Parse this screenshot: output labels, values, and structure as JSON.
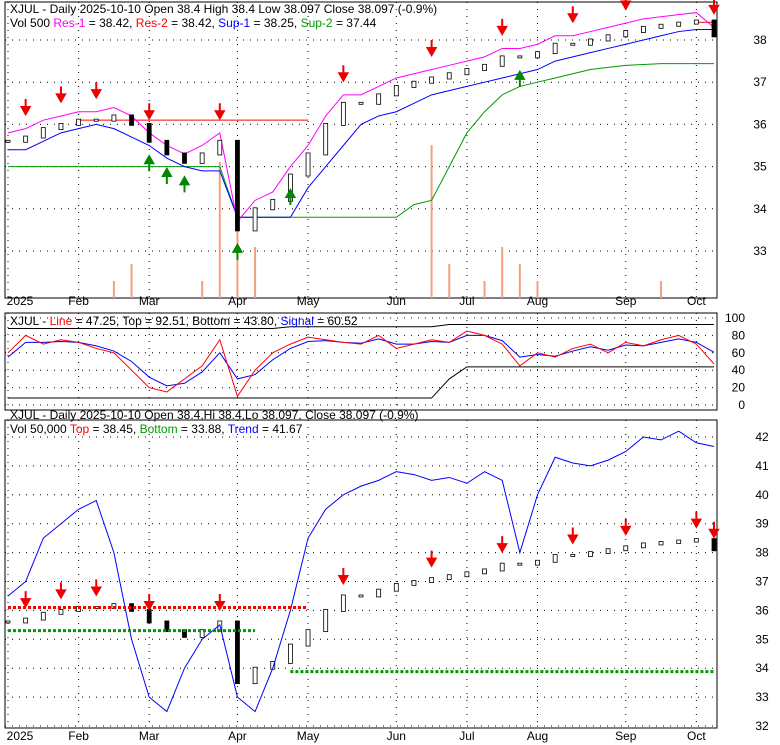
{
  "colors": {
    "res1": "#ff00ff",
    "res2": "#ff0000",
    "sup1": "#0000ff",
    "sup2": "#009900",
    "line": "#ff0000",
    "signal": "#0000ff",
    "top": "#ff0000",
    "bottom": "#009900",
    "trend": "#0000ff",
    "volume": "#f4a080"
  },
  "panel1": {
    "ticker": "XJUL",
    "title": "XJUL - Daily 2025-10-10 Open 38.4  High 38.4  Low 38.097  Close 38.097 (-0.9%)",
    "vol": "Vol 500",
    "res1_label": "Res-1",
    "res1_val": " = 38.42, ",
    "res2_label": "Res-2",
    "res2_val": " = 38.42, ",
    "sup1_label": "Sup-1",
    "sup1_val": " = 38.25, ",
    "sup2_label": "Sup-2",
    "sup2_val": " = 37.44",
    "yticks": [
      33,
      34,
      35,
      36,
      37,
      38
    ]
  },
  "panel2": {
    "title_pre": "XJUL - ",
    "line_label": "Line",
    "line_val": " = 47.25, Top = 92.51, Bottom = 43.80, ",
    "signal_label": "Signal",
    "signal_val": " = 60.52",
    "yticks": [
      0,
      20,
      40,
      60,
      80,
      100
    ]
  },
  "panel3": {
    "title": "XJUL - Daily 2025-10-10 Open 38.4,Hi 38.4,Lo 38.097, Close 38.097 (-0.9%)",
    "vol": "Vol 50,000 ",
    "top_label": "Top",
    "top_val": " = 38.45, ",
    "bottom_label": "Bottom",
    "bottom_val": " = 33.88, ",
    "trend_label": "Trend",
    "trend_val": " = 41.67",
    "yticks": [
      32,
      33,
      34,
      35,
      36,
      37,
      38,
      39,
      40,
      41,
      42
    ]
  },
  "x_labels": [
    "2025",
    "Feb",
    "Mar",
    "Apr",
    "May",
    "Jun",
    "Jul",
    "Aug",
    "Sep",
    "Oct"
  ],
  "chart_data": {
    "type": "line",
    "x_label_index": [
      0,
      4,
      8,
      13,
      17,
      22,
      26,
      30,
      35,
      39
    ],
    "close": [
      35.6,
      35.7,
      35.9,
      36.0,
      36.1,
      36.1,
      36.2,
      36.0,
      35.6,
      35.3,
      35.1,
      35.3,
      35.6,
      33.5,
      34.0,
      34.2,
      34.8,
      35.3,
      36.0,
      36.5,
      36.5,
      36.7,
      36.9,
      37.0,
      37.1,
      37.2,
      37.3,
      37.4,
      37.6,
      37.6,
      37.7,
      37.9,
      37.9,
      38.0,
      38.1,
      38.2,
      38.3,
      38.35,
      38.4,
      38.45,
      38.097
    ],
    "res2": [
      null,
      null,
      null,
      null,
      36.1,
      36.1,
      36.1,
      36.1,
      36.1,
      36.1,
      36.1,
      36.1,
      36.1,
      36.1,
      36.1,
      36.1,
      36.1,
      36.1,
      null,
      null,
      null,
      null,
      null,
      null,
      null,
      null,
      null,
      null,
      null,
      null,
      null,
      null,
      null,
      null,
      null,
      null,
      null,
      null,
      null,
      38.42,
      38.42
    ],
    "sup1": [
      35.4,
      35.4,
      35.6,
      35.8,
      35.9,
      36,
      35.9,
      35.7,
      35.5,
      35.2,
      35,
      34.9,
      34.9,
      33.8,
      33.8,
      33.8,
      33.8,
      34.5,
      35,
      35.5,
      36,
      36.2,
      36.3,
      36.5,
      36.7,
      36.8,
      36.9,
      37,
      37.1,
      37.2,
      37.3,
      37.5,
      37.6,
      37.7,
      37.8,
      37.9,
      38.0,
      38.1,
      38.2,
      38.25,
      38.25
    ],
    "sup2": [
      35,
      35,
      35,
      35,
      35,
      35,
      35,
      35,
      35,
      35,
      35,
      35,
      35,
      33.8,
      33.8,
      33.8,
      33.8,
      33.8,
      33.8,
      33.8,
      33.8,
      33.8,
      33.8,
      34.1,
      34.2,
      35,
      35.8,
      36.3,
      36.7,
      36.9,
      37.0,
      37.1,
      37.2,
      37.3,
      37.35,
      37.4,
      37.42,
      37.44,
      37.44,
      37.44,
      37.44
    ],
    "osc_line": [
      60,
      80,
      70,
      75,
      72,
      65,
      60,
      40,
      20,
      15,
      30,
      45,
      75,
      10,
      40,
      60,
      70,
      78,
      75,
      72,
      70,
      80,
      65,
      70,
      75,
      72,
      85,
      80,
      70,
      45,
      60,
      55,
      65,
      70,
      60,
      72,
      68,
      75,
      80,
      70,
      47.25
    ],
    "osc_signal": [
      55,
      72,
      72,
      73,
      72,
      68,
      62,
      50,
      32,
      22,
      25,
      38,
      60,
      30,
      35,
      52,
      65,
      73,
      74,
      72,
      71,
      76,
      70,
      70,
      73,
      72,
      80,
      80,
      74,
      55,
      58,
      56,
      62,
      67,
      63,
      69,
      68,
      72,
      76,
      72,
      60.52
    ],
    "osc_top": [
      88,
      88,
      88,
      88,
      88,
      88,
      88,
      88,
      88,
      88,
      88,
      88,
      88,
      88,
      88,
      88,
      90,
      90,
      90,
      90,
      90,
      90,
      90,
      90,
      90,
      92.5,
      92.5,
      92.5,
      92.5,
      92.5,
      92.5,
      92.5,
      92.5,
      92.5,
      92.5,
      92.5,
      92.5,
      92.5,
      92.5,
      92.5,
      92.51
    ],
    "osc_bottom": [
      8,
      8,
      8,
      8,
      8,
      8,
      8,
      8,
      8,
      8,
      8,
      8,
      8,
      8,
      8,
      8,
      8,
      8,
      8,
      8,
      8,
      8,
      8,
      8,
      8,
      30,
      43.8,
      43.8,
      43.8,
      43.8,
      43.8,
      43.8,
      43.8,
      43.8,
      43.8,
      43.8,
      43.8,
      43.8,
      43.8,
      43.8,
      43.8
    ],
    "trend": [
      36.5,
      37,
      38.5,
      39,
      39.5,
      39.8,
      38,
      35,
      33,
      32.5,
      34,
      35,
      35.5,
      33,
      32.5,
      34,
      36,
      38.5,
      39.5,
      40,
      40.3,
      40.5,
      40.8,
      40.7,
      40.5,
      40.6,
      40.4,
      40.8,
      40.5,
      38,
      40,
      41.3,
      41.1,
      41,
      41.2,
      41.5,
      42,
      41.9,
      42.2,
      41.8,
      41.67
    ],
    "volume": [
      0,
      0,
      0,
      0,
      0,
      0,
      1,
      2,
      0,
      0,
      0,
      1,
      8,
      9,
      3,
      0,
      0,
      0,
      0,
      0,
      0,
      0,
      0,
      0,
      9,
      2,
      0,
      1,
      3,
      2,
      1,
      0,
      0,
      0,
      0,
      0,
      0,
      1,
      0,
      0,
      0
    ],
    "sell_signals": [
      1,
      3,
      5,
      8,
      12,
      19,
      24,
      28,
      32,
      35,
      39,
      40
    ],
    "buy_signals": [
      8,
      9,
      10,
      13,
      16,
      29
    ],
    "ylim_price": [
      32.7,
      39
    ],
    "ylim_osc": [
      0,
      100
    ],
    "ylim_trend": [
      32,
      42.5
    ]
  }
}
